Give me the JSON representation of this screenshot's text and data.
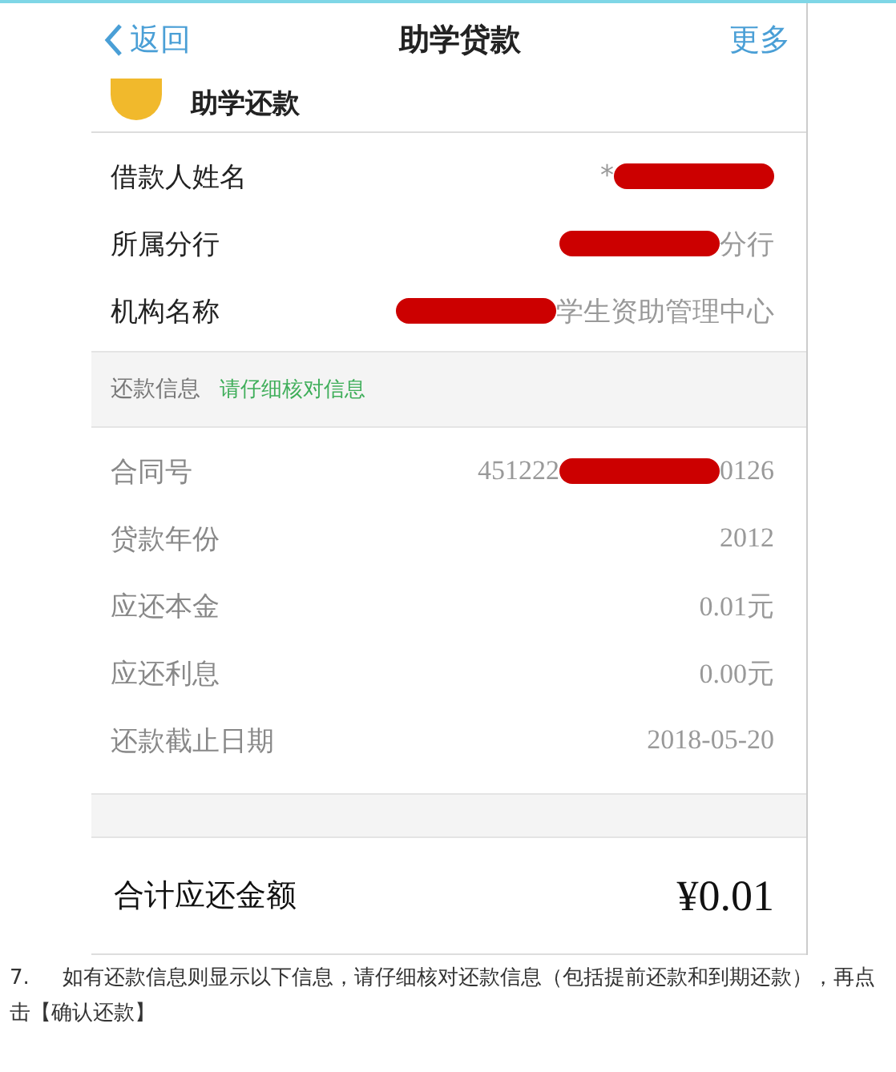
{
  "nav": {
    "back": "返回",
    "title": "助学贷款",
    "more": "更多"
  },
  "banner": {
    "title": "助学还款"
  },
  "borrower_fields": [
    {
      "label": "借款人姓名",
      "value": [
        {
          "kind": "text",
          "text": "*"
        },
        {
          "kind": "redaction"
        }
      ]
    },
    {
      "label": "所属分行",
      "value": [
        {
          "kind": "redaction"
        },
        {
          "kind": "text",
          "text": "分行"
        }
      ]
    },
    {
      "label": "机构名称",
      "value": [
        {
          "kind": "redaction"
        },
        {
          "kind": "text",
          "text": "学生资助管理中心"
        }
      ]
    }
  ],
  "repayment_section": {
    "title": "还款信息",
    "hint": "请仔细核对信息"
  },
  "repayment_fields": [
    {
      "label": "合同号",
      "value": [
        {
          "kind": "text",
          "text": "451222"
        },
        {
          "kind": "redaction"
        },
        {
          "kind": "text",
          "text": "0126"
        }
      ]
    },
    {
      "label": "贷款年份",
      "value": [
        {
          "kind": "text",
          "text": "2012"
        }
      ]
    },
    {
      "label": "应还本金",
      "value": [
        {
          "kind": "text",
          "text": "0.01元"
        }
      ]
    },
    {
      "label": "应还利息",
      "value": [
        {
          "kind": "text",
          "text": "0.00元"
        }
      ]
    },
    {
      "label": "还款截止日期",
      "value": [
        {
          "kind": "text",
          "text": "2018-05-20"
        }
      ]
    }
  ],
  "total": {
    "label": "合计应还金额",
    "amount": "¥0.01"
  },
  "caption": {
    "number": "7.",
    "text": "如有还款信息则显示以下信息，请仔细核对还款信息（包括提前还款和到期还款），再点击【确认还款】"
  }
}
